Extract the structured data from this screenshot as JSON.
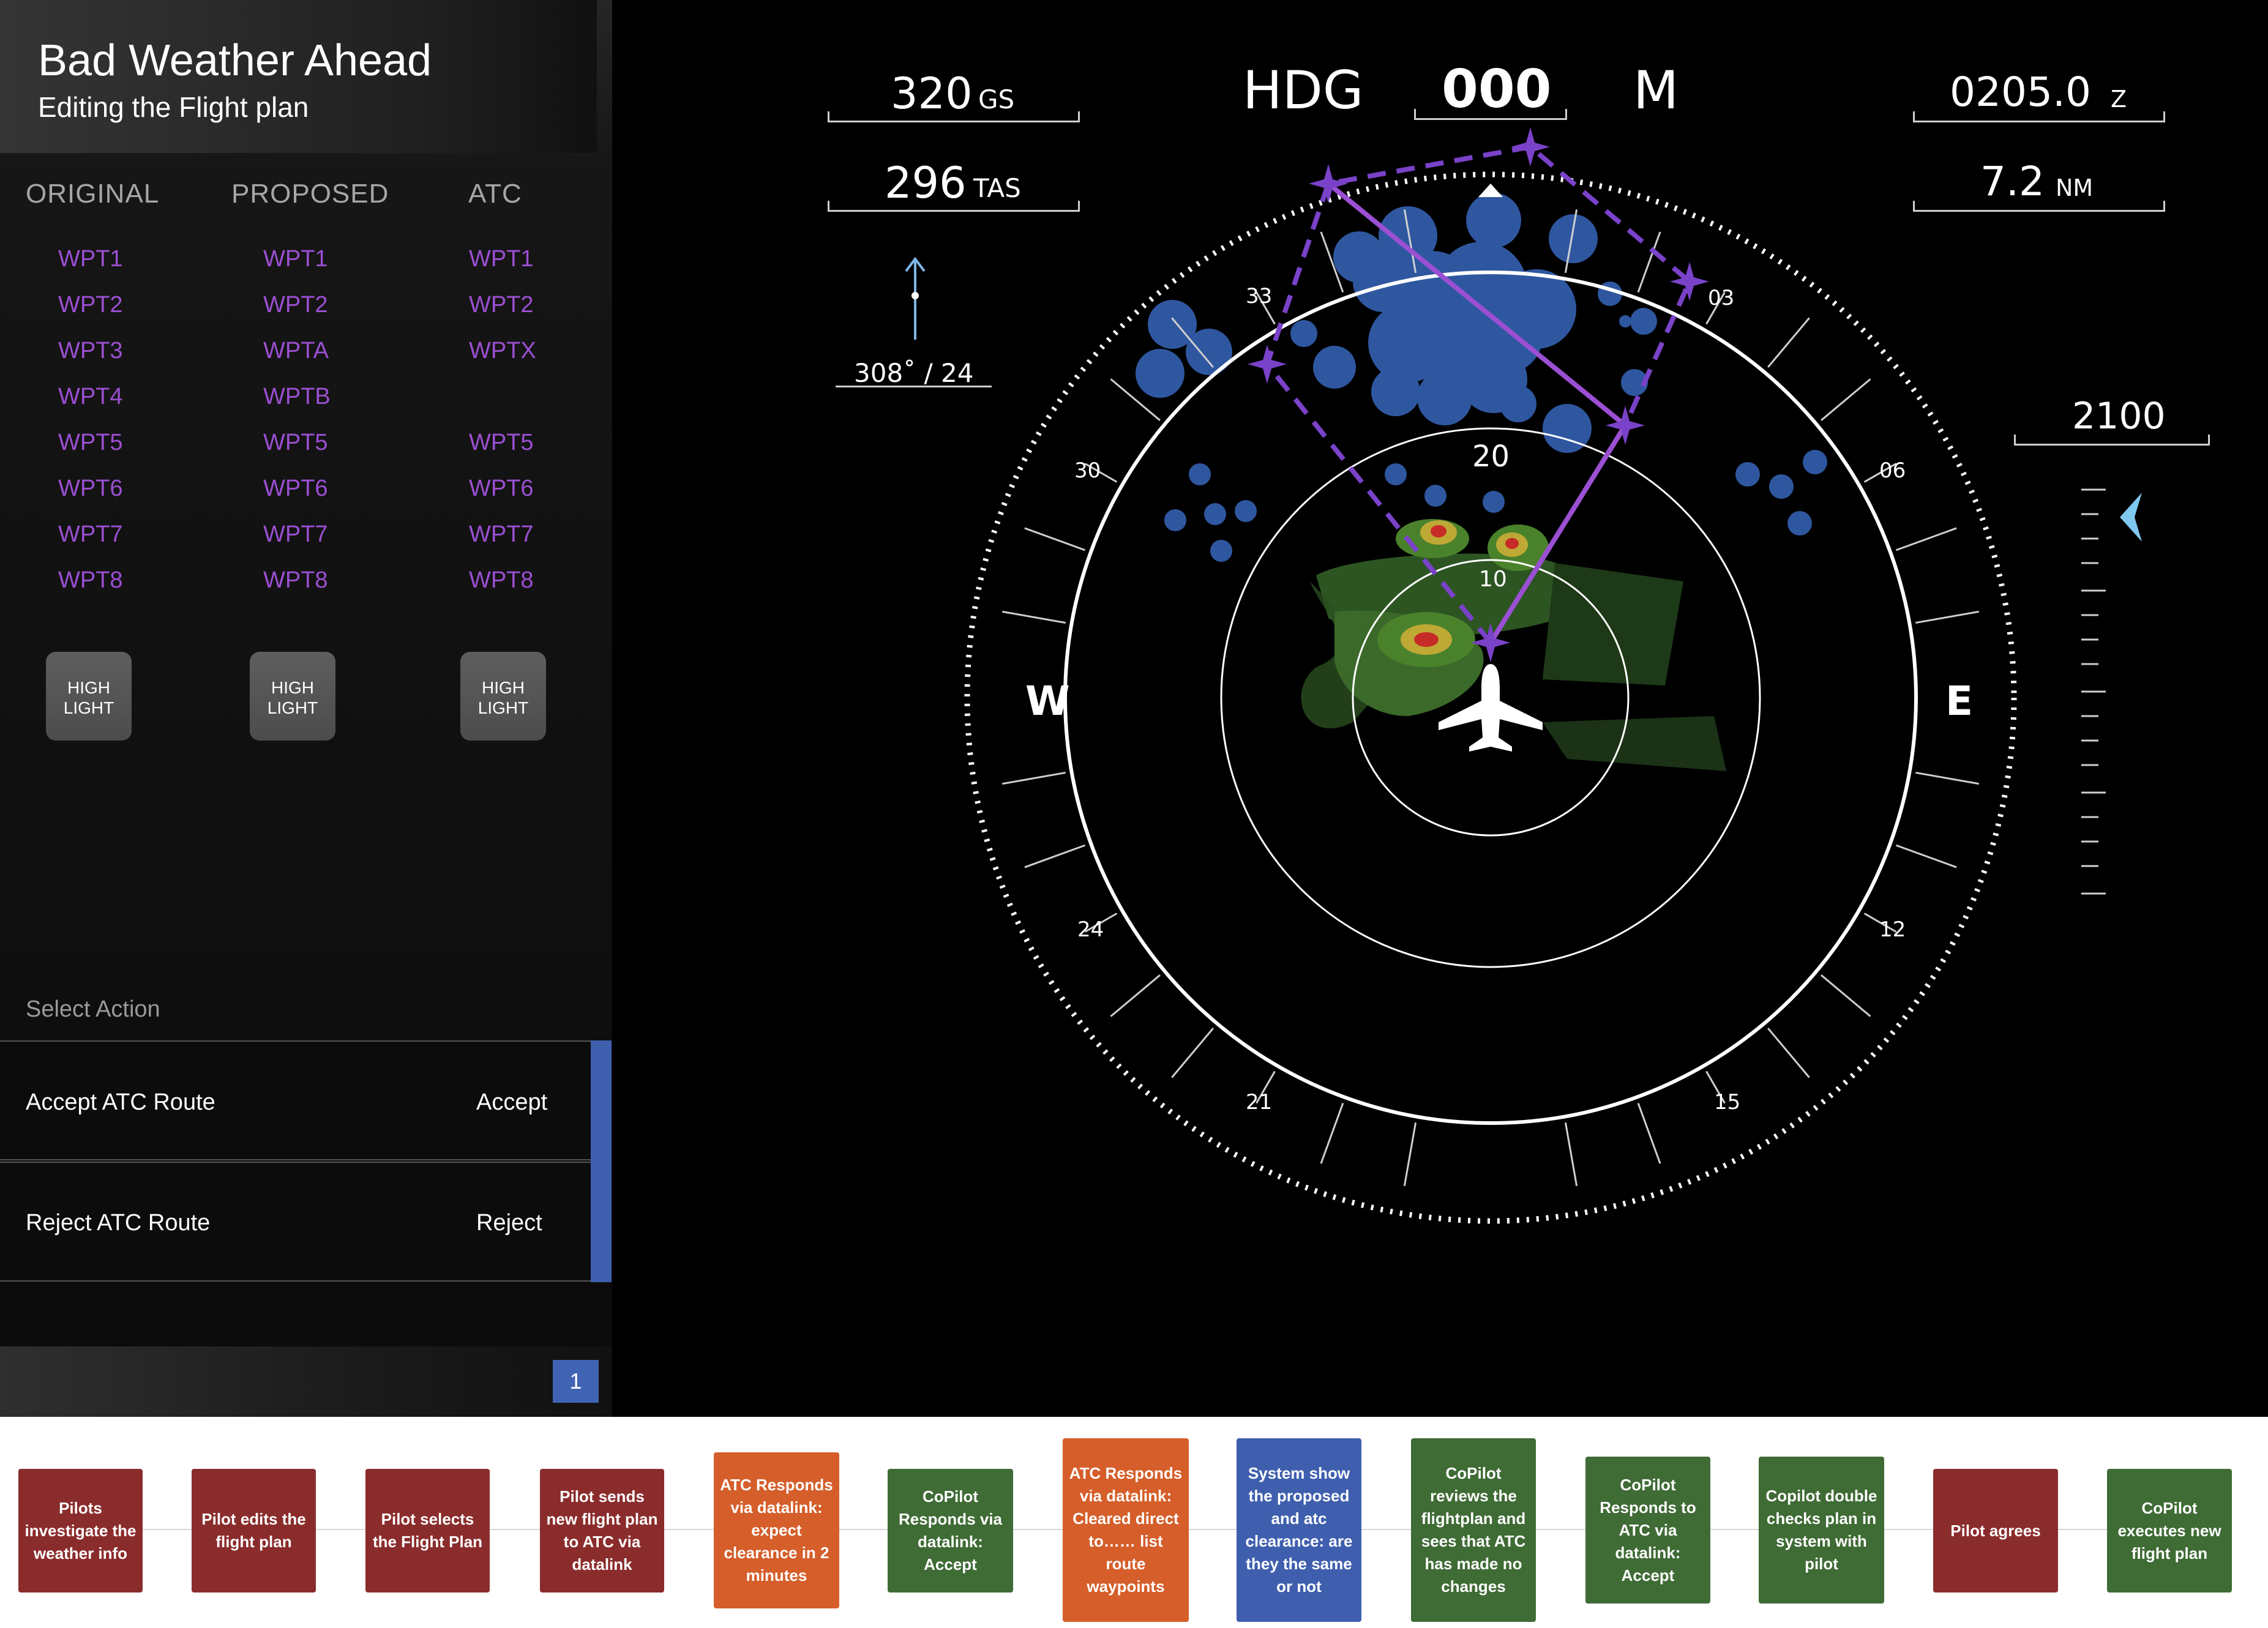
{
  "header": {
    "title": "Bad Weather Ahead",
    "subtitle": "Editing the Flight plan"
  },
  "columns": [
    {
      "name": "ORIGINAL",
      "waypoints": [
        "WPT1",
        "WPT2",
        "WPT3",
        "WPT4",
        "WPT5",
        "WPT6",
        "WPT7",
        "WPT8"
      ]
    },
    {
      "name": "PROPOSED",
      "waypoints": [
        "WPT1",
        "WPT2",
        "WPTA",
        "WPTB",
        "WPT5",
        "WPT6",
        "WPT7",
        "WPT8"
      ]
    },
    {
      "name": "ATC",
      "waypoints": [
        "WPT1",
        "WPT2",
        "WPTX",
        "",
        "WPT5",
        "WPT6",
        "WPT7",
        "WPT8"
      ]
    }
  ],
  "highlight_label": "HIGH LIGHT",
  "actions": {
    "title": "Select Action",
    "items": [
      {
        "label": "Accept ATC Route",
        "button": "Accept"
      },
      {
        "label": "Reject ATC Route",
        "button": "Reject"
      }
    ]
  },
  "page_number": "1",
  "readouts": {
    "ground_speed": "320",
    "ground_speed_unit": "GS",
    "true_airspeed": "296",
    "true_airspeed_unit": "TAS",
    "heading_label": "HDG",
    "heading_value": "000",
    "heading_ref": "M",
    "time": "0205.0",
    "time_unit": "Z",
    "distance": "7.2",
    "distance_unit": "NM",
    "wind": "308˚ / 24",
    "altitude": "2100"
  },
  "compass": {
    "cardinal_w": "W",
    "cardinal_e": "E",
    "labels": [
      "03",
      "06",
      "12",
      "15",
      "21",
      "24",
      "30",
      "33"
    ],
    "range_rings": [
      "20",
      "10"
    ]
  },
  "colors": {
    "route_solid": "#9b4fd2",
    "route_dashed": "#7a42c9",
    "weather_cells": "#3f74d6",
    "action_bar": "#3f5fae"
  },
  "flow_steps": [
    {
      "text": "Pilots investigate the weather info",
      "color": "#8b2c2c"
    },
    {
      "text": "Pilot edits the flight plan",
      "color": "#8b2c2c"
    },
    {
      "text": "Pilot selects the Flight Plan",
      "color": "#8b2c2c"
    },
    {
      "text": "Pilot sends new flight plan to ATC via datalink",
      "color": "#8b2c2c"
    },
    {
      "text": "ATC Responds via datalink: expect clearance in 2 minutes",
      "color": "#d55e2a"
    },
    {
      "text": "CoPilot Responds via datalink: Accept",
      "color": "#3f6b35"
    },
    {
      "text": "ATC Responds via datalink: Cleared direct to…… list route waypoints",
      "color": "#d55e2a"
    },
    {
      "text": "System show the proposed and atc clearance: are they the same or not",
      "color": "#3f5fae"
    },
    {
      "text": "CoPilot reviews the flightplan and sees that ATC has made no changes",
      "color": "#3f6b35"
    },
    {
      "text": "CoPilot Responds to ATC via datalink: Accept",
      "color": "#3f6b35"
    },
    {
      "text": "Copilot double checks plan in system with pilot",
      "color": "#3f6b35"
    },
    {
      "text": "Pilot agrees",
      "color": "#8b2c2c"
    },
    {
      "text": "CoPilot executes new flight plan",
      "color": "#3f6b35"
    }
  ]
}
